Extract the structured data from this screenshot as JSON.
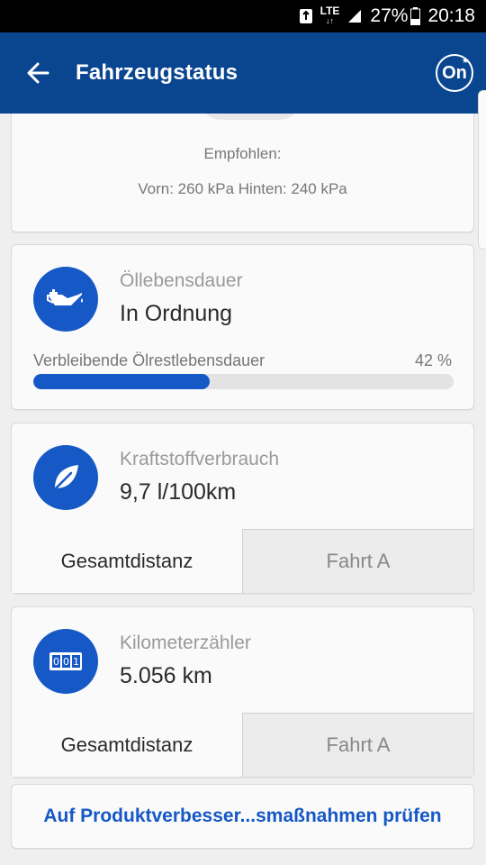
{
  "status_bar": {
    "network": "LTE",
    "battery": "27%",
    "time": "20:18"
  },
  "app_bar": {
    "title": "Fahrzeugstatus",
    "onstar_label": "On"
  },
  "tire_pressure": {
    "recommended_label": "Empfohlen:",
    "values": "Vorn: 260 kPa Hinten: 240 kPa"
  },
  "oil_life": {
    "label": "Öllebensdauer",
    "status": "In Ordnung",
    "bar_label": "Verbleibende Ölrestlebensdauer",
    "percent_text": "42 %",
    "percent": 42
  },
  "fuel": {
    "label": "Kraftstoffverbrauch",
    "value": "9,7 l/100km",
    "tabs": [
      "Gesamtdistanz",
      "Fahrt A"
    ]
  },
  "odometer": {
    "label": "Kilometerzähler",
    "value": "5.056 km",
    "tabs": [
      "Gesamtdistanz",
      "Fahrt A"
    ]
  },
  "link": {
    "label": "Auf Produktverbesser...smaßnahmen prüfen"
  },
  "colors": {
    "app_bar": "#0a4690",
    "accent": "#1558c6"
  }
}
